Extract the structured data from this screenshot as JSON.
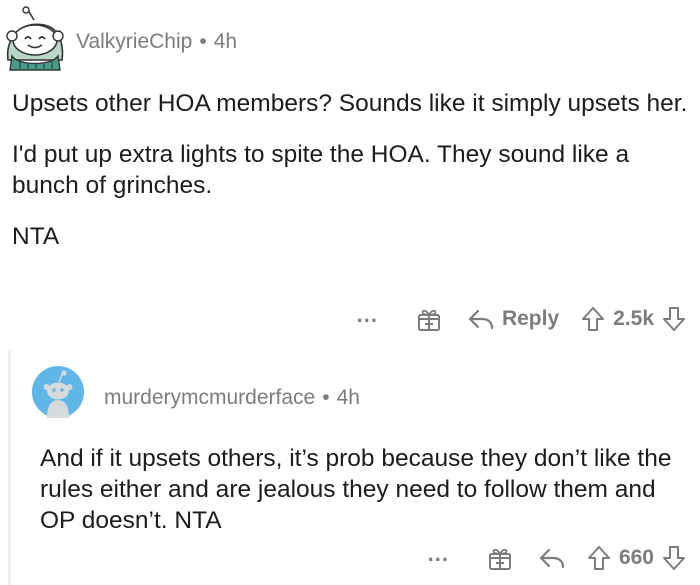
{
  "comment": {
    "username": "ValkyrieChip",
    "time": "4h",
    "paragraphs": [
      "Upsets other HOA members? Sounds like it simply upsets her.",
      "I'd put up extra lights to spite the HOA. They sound like a bunch of grinches.",
      "NTA"
    ],
    "actions": {
      "more": "...",
      "reply_label": "Reply",
      "vote_count": "2.5k"
    }
  },
  "reply": {
    "username": "murderymcmurderface",
    "time": "4h",
    "paragraphs": [
      "And if it upsets others, it’s prob because they don’t like the rules either and are jealous they need to follow them and OP doesn’t. NTA"
    ],
    "actions": {
      "more": "...",
      "vote_count": "660"
    }
  },
  "separator": "•",
  "icons": {
    "avatar1": "snoo-avatar-icon",
    "avatar2": "snoo-default-avatar-icon",
    "gift": "award-gift-icon",
    "reply": "reply-arrow-icon",
    "upvote": "upvote-arrow-icon",
    "downvote": "downvote-arrow-icon"
  },
  "colors": {
    "text": "#1c1c1c",
    "meta": "#7c7c7c",
    "avatar2_bg": "#5fb7e8",
    "avatar1_accent": "#4a9a8a"
  }
}
